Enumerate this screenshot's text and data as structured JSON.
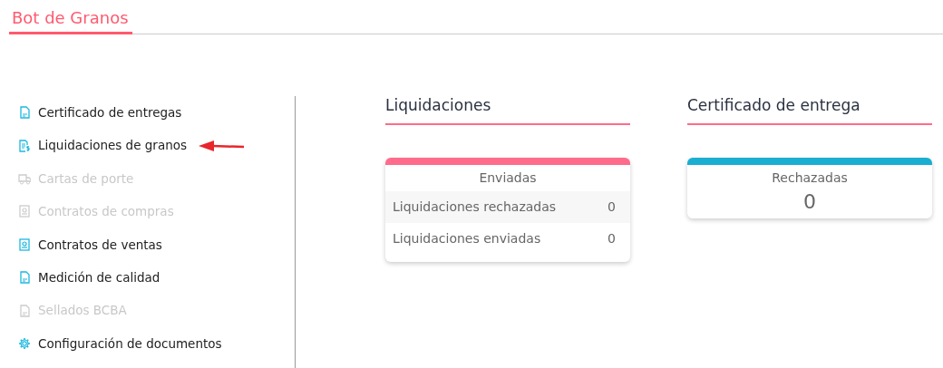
{
  "header": {
    "tab": {
      "label": "Bot de Granos",
      "selected": true
    }
  },
  "sidebar": {
    "items": [
      {
        "label": "Certificado de entregas",
        "kind": "document",
        "disabled": false,
        "pointed": false
      },
      {
        "label": "Liquidaciones de granos",
        "kind": "invoice",
        "disabled": false,
        "pointed": true
      },
      {
        "label": "Cartas de porte",
        "kind": "transport",
        "disabled": true,
        "pointed": false
      },
      {
        "label": "Contratos de compras",
        "kind": "contract",
        "disabled": true,
        "pointed": false
      },
      {
        "label": "Contratos de ventas",
        "kind": "contract",
        "disabled": false,
        "pointed": false
      },
      {
        "label": "Medición de calidad",
        "kind": "document",
        "disabled": false,
        "pointed": false
      },
      {
        "label": "Sellados BCBA",
        "kind": "document",
        "disabled": true,
        "pointed": false
      },
      {
        "label": "Configuración de documentos",
        "kind": "settings",
        "disabled": false,
        "pointed": false
      }
    ]
  },
  "sections": [
    {
      "title": "Liquidaciones",
      "card": {
        "kind": "list",
        "color": "#ff6b8b",
        "heading": "Enviadas",
        "rows": [
          {
            "label": "Liquidaciones rechazadas",
            "value": "0"
          },
          {
            "label": "Liquidaciones enviadas",
            "value": "0"
          }
        ]
      }
    },
    {
      "title": "Certificado de entrega",
      "card": {
        "kind": "single",
        "color": "#1aaed1",
        "heading": "Rechazadas",
        "value": "0"
      }
    }
  ]
}
